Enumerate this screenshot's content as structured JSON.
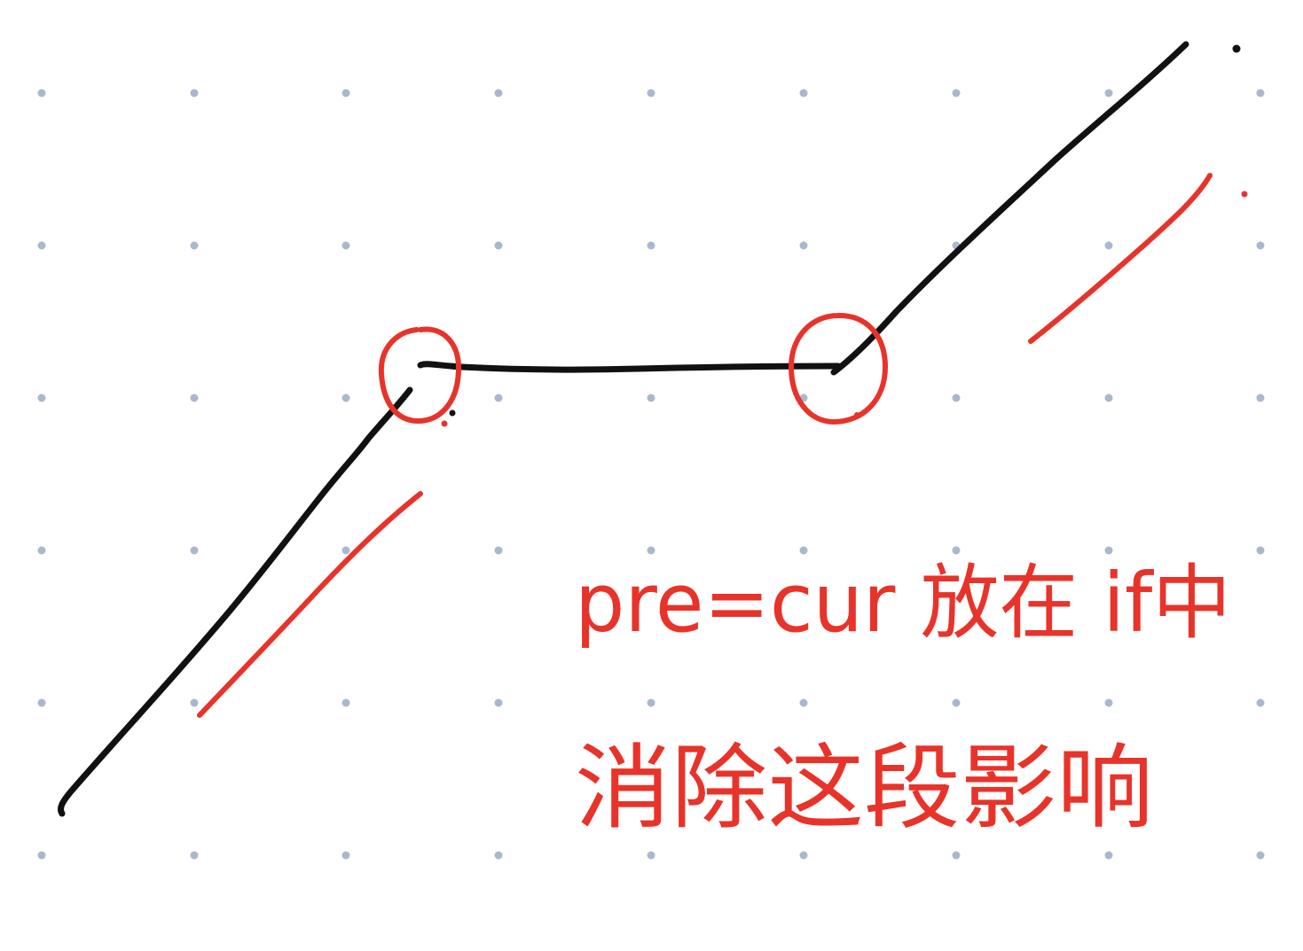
{
  "note": {
    "line1": "pre=cur 放在 if中",
    "line2": "消除这段影响"
  },
  "colors": {
    "ink_black": "#111111",
    "ink_red": "#e8332a",
    "grid_dot": "#a9b8cf",
    "background": "#ffffff"
  }
}
